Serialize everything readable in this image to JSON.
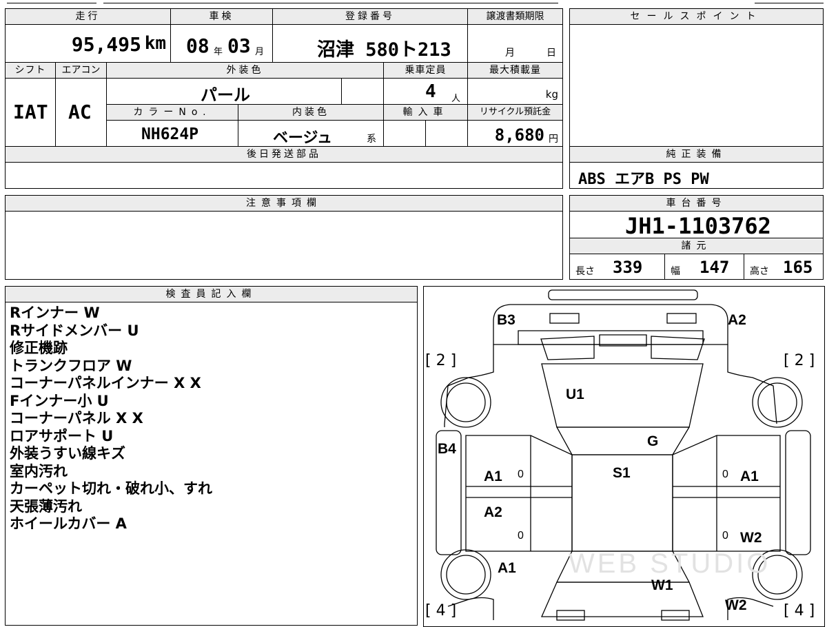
{
  "top_block": {
    "hdr_mileage": "走行",
    "hdr_inspection": "車検",
    "hdr_registration": "登録番号",
    "hdr_transfer_deadline": "譲渡書類期限",
    "mileage_value": "95,495",
    "mileage_unit": "km",
    "inspection_year": "08",
    "inspection_year_unit": "年",
    "inspection_month": "03",
    "inspection_month_unit": "月",
    "registration_number": "沼津 580ト213",
    "deadline_month": "月",
    "deadline_day": "日",
    "hdr_shift": "シフト",
    "hdr_aircon": "エアコン",
    "hdr_exterior_color": "外装色",
    "hdr_capacity": "乗車定員",
    "hdr_max_load": "最大積載量",
    "shift_value": "IAT",
    "aircon_value": "AC",
    "exterior_color_value": "パール",
    "capacity_value": "4",
    "capacity_unit": "人",
    "max_load_unit": "kg",
    "hdr_color_no": "カラーNo.",
    "hdr_interior_color": "内装色",
    "hdr_import": "輸入車",
    "hdr_recycle": "リサイクル預託金",
    "color_no_value": "NH624P",
    "interior_color_value": "ベージュ",
    "interior_color_suffix": "系",
    "recycle_value": "8,680",
    "recycle_unit": "円",
    "hdr_later_parts": "後日発送部品"
  },
  "sales_point": {
    "header": "セールスポイント"
  },
  "genuine_equipment": {
    "header": "純正装備",
    "value": "ABS エアB PS PW"
  },
  "notes": {
    "header": "注意事項欄"
  },
  "chassis": {
    "header": "車台番号",
    "value": "JH1-1103762",
    "spec_header": "諸元",
    "length_label": "長さ",
    "length_value": "339",
    "width_label": "幅",
    "width_value": "147",
    "height_label": "高さ",
    "height_value": "165"
  },
  "inspector": {
    "header": "検査員記入欄",
    "items": [
      "Rインナー W",
      "Rサイドメンバー U",
      "修正機跡",
      "トランクフロア W",
      "コーナーパネルインナー X X",
      "Fインナー小 U",
      "コーナーパネル X X",
      "ロアサポート U",
      "外装うすい線キズ",
      "室内汚れ",
      "カーペット切れ・破れ小、すれ",
      "天張薄汚れ",
      "ホイールカバー A"
    ]
  },
  "diagram": {
    "labels": {
      "b3": "B3",
      "a2_top": "A2",
      "u1": "U1",
      "g": "G",
      "b4": "B4",
      "s1": "S1",
      "a1_left": "A1",
      "a1_right": "A1",
      "a2_left": "A2",
      "w2_right": "W2",
      "a1_bottom": "A1",
      "w1": "W1",
      "w2_bottom": "W2"
    },
    "zeros": {
      "z1": "0",
      "z2": "0",
      "z3": "0",
      "z4": "0"
    },
    "brackets": {
      "front_left": "[ 2 ]",
      "front_right": "[ 2 ]",
      "rear_left": "[ 4 ]",
      "rear_right": "[ 4 ]"
    },
    "watermark": "WEB STUDIO"
  }
}
